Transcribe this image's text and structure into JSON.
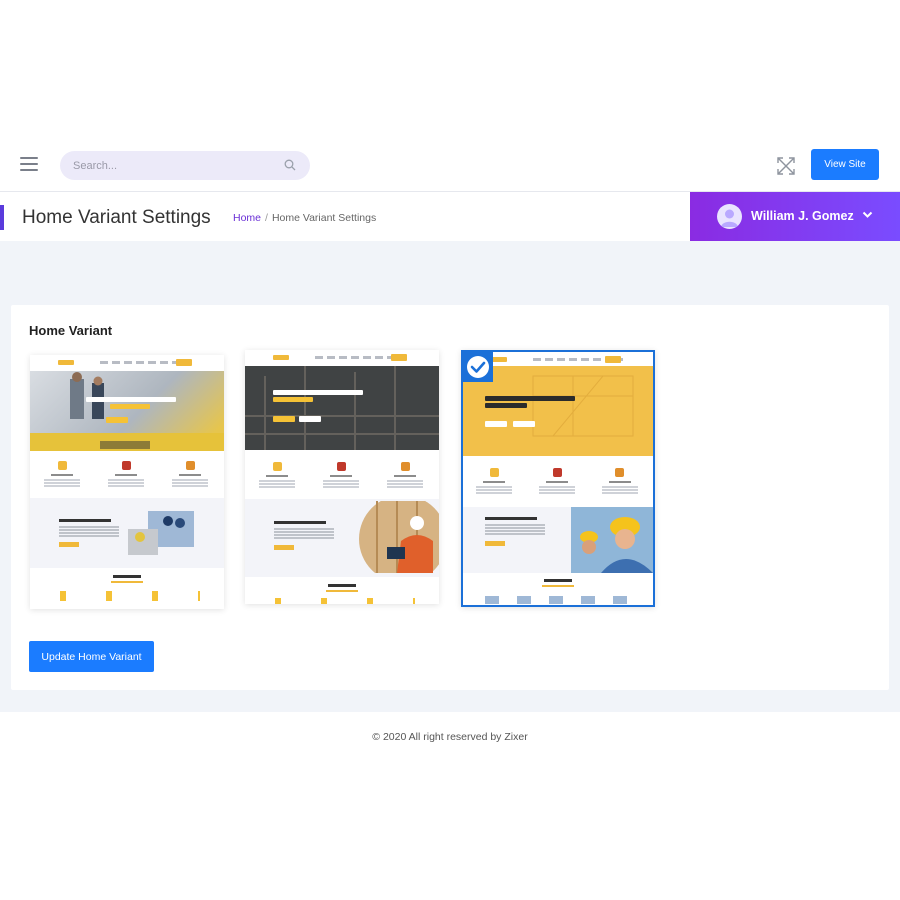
{
  "topbar": {
    "search_placeholder": "Search...",
    "view_site_label": "View Site"
  },
  "page": {
    "title": "Home Variant Settings",
    "breadcrumb": {
      "home": "Home",
      "separator": "/",
      "current": "Home Variant Settings"
    }
  },
  "user": {
    "name": "William J. Gomez"
  },
  "card": {
    "title": "Home Variant",
    "variants": [
      {
        "hero_title": "VIRTUALLY BUILD YOUR HOUSE",
        "hero_highlight": "IN FEW STEPS",
        "section_title": "BUILD YOUR DREAM HOME",
        "services_title": "OUR SERVICES",
        "selected": false
      },
      {
        "hero_title": "VIRTUALLY BUILD YOUR HOUSE",
        "hero_highlight": "IN FEW STEPS",
        "section_title": "BUILD YOUR DREAM HOME",
        "services_title": "OUR SERVICES",
        "selected": false
      },
      {
        "hero_title": "VIRTUALLY BUILD YOUR HOUSE",
        "hero_highlight": "IN FEW STEPS",
        "section_title": "BUILD YOUR DREAM HOME",
        "services_title": "OUR SERVICES",
        "selected": true
      }
    ],
    "update_button_label": "Update Home Variant"
  },
  "footer": {
    "text": "© 2020 All right reserved by Zixer"
  },
  "colors": {
    "primary": "#1b7cff",
    "accent_purple": "#7a4cff",
    "selected_border": "#1b70d8",
    "brand_yellow": "#f5c236"
  }
}
